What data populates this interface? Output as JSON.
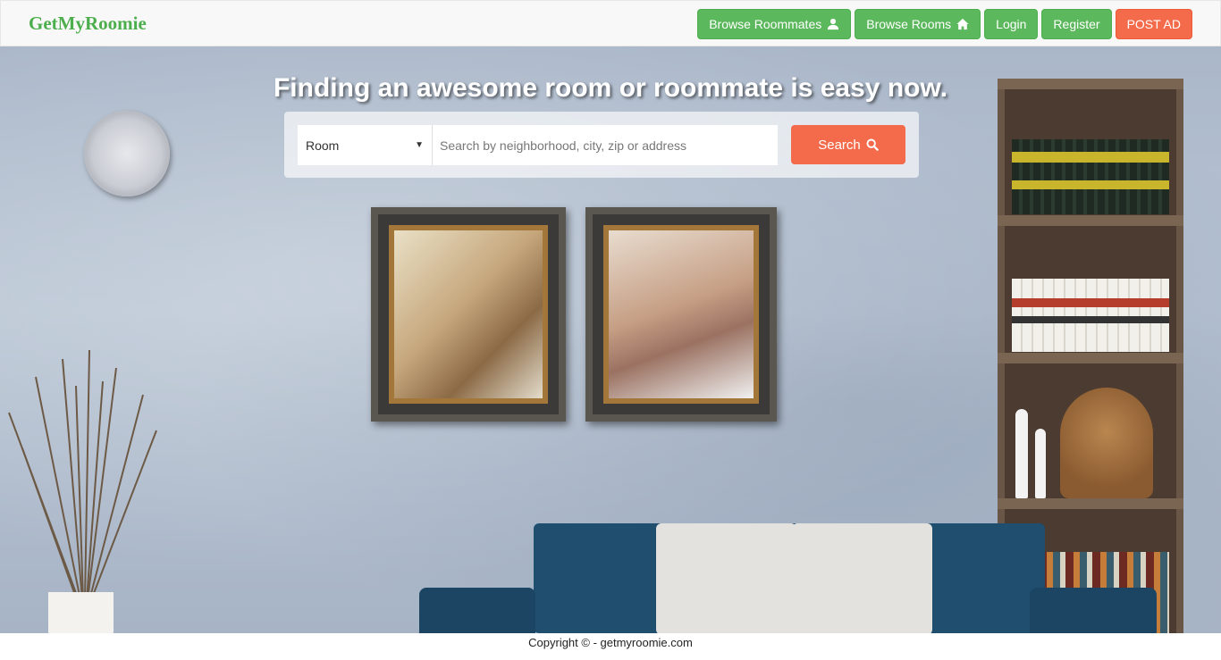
{
  "navbar": {
    "brand": "GetMyRoomie",
    "buttons": [
      {
        "label": "Browse Roommates",
        "icon": "user-icon"
      },
      {
        "label": "Browse Rooms",
        "icon": "home-icon"
      },
      {
        "label": "Login"
      },
      {
        "label": "Register"
      },
      {
        "label": "POST AD"
      }
    ]
  },
  "hero": {
    "title": "Finding an awesome room or roommate is easy now.",
    "search": {
      "type_selected": "Room",
      "placeholder": "Search by neighborhood, city, zip or address",
      "button_label": "Search",
      "button_icon": "search-icon"
    }
  },
  "footer": {
    "copyright": "Copyright © - getmyroomie.com"
  },
  "colors": {
    "brand": "#4cae4c",
    "button_green": "#5cb85c",
    "button_orange": "#f46b4b"
  }
}
